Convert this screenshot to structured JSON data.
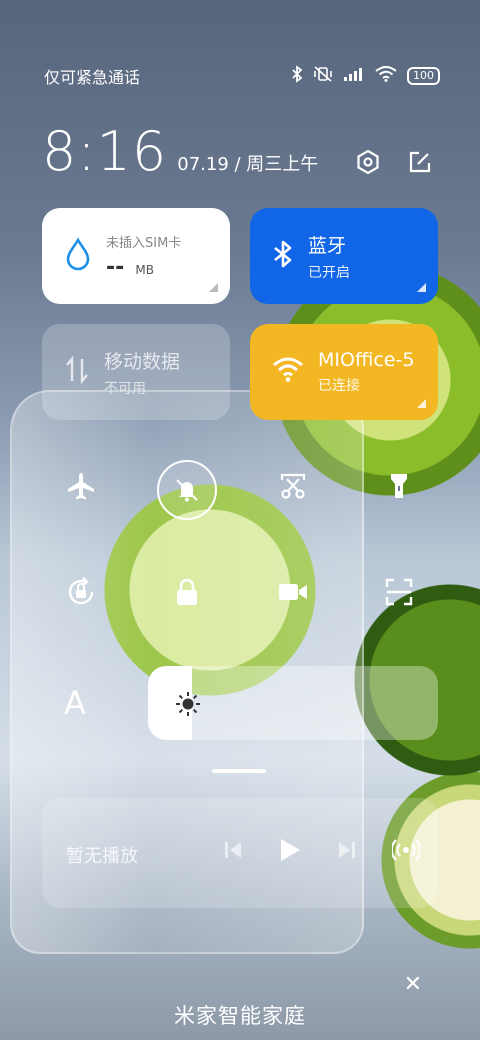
{
  "status_bar": {
    "carrier": "仅可紧急通话",
    "battery": "100",
    "icons": [
      "bluetooth-icon",
      "vibrate-mute-icon",
      "signal-icon",
      "wifi-icon",
      "battery-icon"
    ]
  },
  "clock": {
    "time": "8:16",
    "date": "07.19 / 周三上午"
  },
  "header_actions": [
    "settings-icon",
    "edit-icon"
  ],
  "tiles": {
    "sim": {
      "label": "未插入SIM卡",
      "value": "--",
      "unit": "MB",
      "icon": "drop-icon"
    },
    "bluetooth": {
      "title": "蓝牙",
      "status": "已开启",
      "icon": "bluetooth-icon",
      "color": "#1166e8"
    },
    "mobile_data": {
      "title": "移动数据",
      "status": "不可用",
      "icon": "data-arrows-icon"
    },
    "wifi": {
      "title": "MIOffice-5",
      "status": "已连接",
      "icon": "wifi-icon",
      "color": "#f4b724"
    }
  },
  "quick_row_1": [
    "airplane-icon",
    "mute-bell-icon",
    "screenshot-scissors-icon",
    "flashlight-icon"
  ],
  "quick_row_2": [
    "auto-rotate-icon",
    "lock-icon",
    "screen-record-icon",
    "scan-icon"
  ],
  "brightness": {
    "level": 0.15,
    "font_label": "A"
  },
  "media": {
    "label": "暂无播放",
    "controls": [
      "previous-icon",
      "play-icon",
      "next-icon",
      "cast-icon"
    ]
  },
  "smart_home": {
    "title": "米家智能家庭",
    "close": "✕"
  }
}
